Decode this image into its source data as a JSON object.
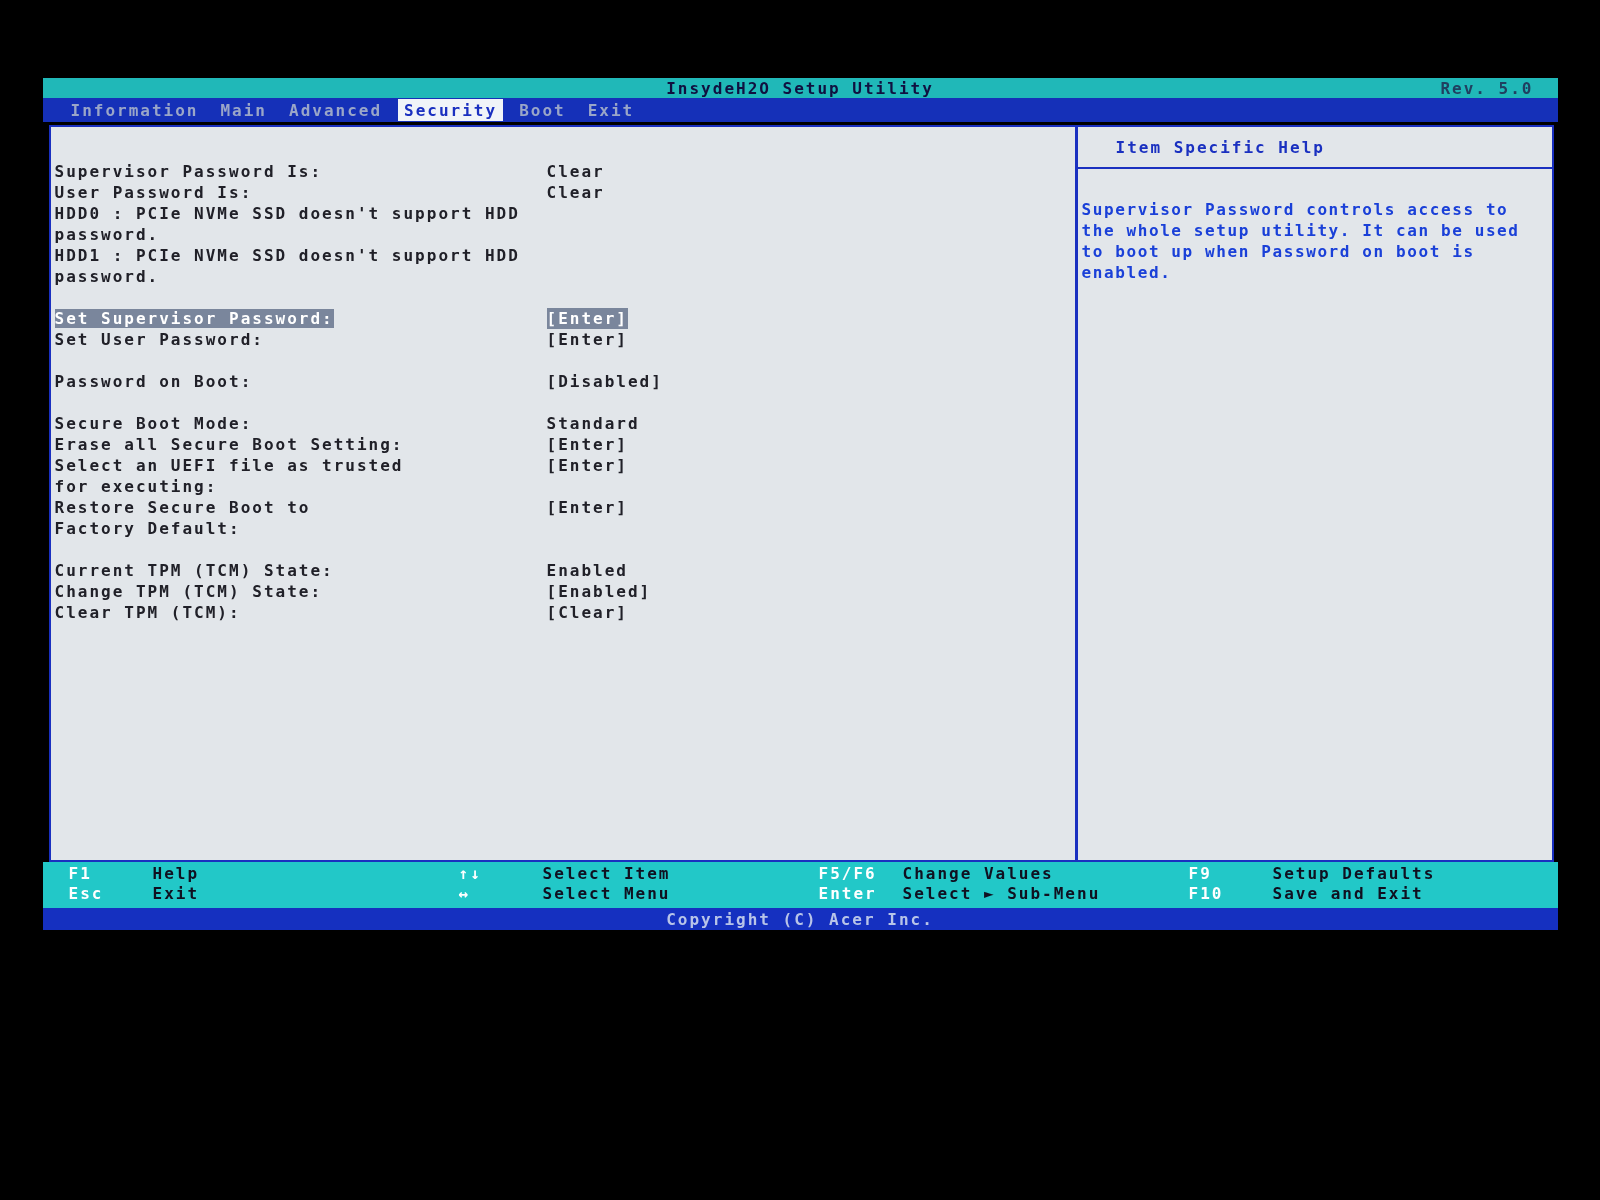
{
  "title_bar": {
    "title": "InsydeH2O Setup Utility",
    "revision": "Rev. 5.0"
  },
  "tabs": [
    {
      "label": "Information",
      "selected": false
    },
    {
      "label": "Main",
      "selected": false
    },
    {
      "label": "Advanced",
      "selected": false
    },
    {
      "label": "Security",
      "selected": true
    },
    {
      "label": "Boot",
      "selected": false
    },
    {
      "label": "Exit",
      "selected": false
    }
  ],
  "sections": [
    {
      "rows": [
        {
          "lines": [
            "Supervisor Password Is:"
          ],
          "value": "Clear",
          "selected": false
        },
        {
          "lines": [
            "User Password Is:"
          ],
          "value": "Clear",
          "selected": false
        },
        {
          "lines": [
            "HDD0 : PCIe NVMe SSD doesn't support HDD",
            "password."
          ],
          "selected": false
        },
        {
          "lines": [
            "HDD1 : PCIe NVMe SSD doesn't support HDD",
            "password."
          ],
          "selected": false
        }
      ]
    },
    {
      "rows": [
        {
          "lines": [
            "Set Supervisor Password:"
          ],
          "value": "[Enter]",
          "selected": true
        },
        {
          "lines": [
            "Set User Password:"
          ],
          "value": "[Enter]",
          "selected": false
        }
      ]
    },
    {
      "rows": [
        {
          "lines": [
            "Password on Boot:"
          ],
          "value": "[Disabled]",
          "selected": false
        }
      ]
    },
    {
      "rows": [
        {
          "lines": [
            "Secure Boot Mode:"
          ],
          "value": "Standard",
          "selected": false
        },
        {
          "lines": [
            "Erase all Secure Boot Setting:"
          ],
          "value": "[Enter]",
          "selected": false
        },
        {
          "lines": [
            "Select an UEFI file as trusted",
            "for executing:"
          ],
          "value": "[Enter]",
          "selected": false
        },
        {
          "lines": [
            "Restore Secure Boot to",
            "Factory Default:"
          ],
          "value": "[Enter]",
          "selected": false
        }
      ]
    },
    {
      "rows": [
        {
          "lines": [
            "Current TPM (TCM) State:"
          ],
          "value": "Enabled",
          "selected": false
        },
        {
          "lines": [
            "Change TPM (TCM) State:"
          ],
          "value": "[Enabled]",
          "selected": false
        },
        {
          "lines": [
            "Clear TPM (TCM):"
          ],
          "value": "[Clear]",
          "selected": false
        }
      ]
    }
  ],
  "help": {
    "title": "Item Specific Help",
    "text": "Supervisor Password controls access to the whole setup utility. It can be used to boot up when Password on boot is enabled."
  },
  "key_help": [
    [
      {
        "key": "F1",
        "action": "Help"
      },
      {
        "key": "Esc",
        "action": "Exit"
      }
    ],
    [
      {
        "key": "↑↓",
        "action": "Select Item"
      },
      {
        "key": "↔",
        "action": "Select Menu"
      }
    ],
    [
      {
        "key": "F5/F6",
        "action": "Change Values"
      },
      {
        "key": "Enter",
        "action": "Select ► Sub-Menu"
      }
    ],
    [
      {
        "key": "F9",
        "action": "Setup Defaults"
      },
      {
        "key": "F10",
        "action": "Save and Exit"
      }
    ]
  ],
  "copyright": "Copyright (C) Acer Inc."
}
